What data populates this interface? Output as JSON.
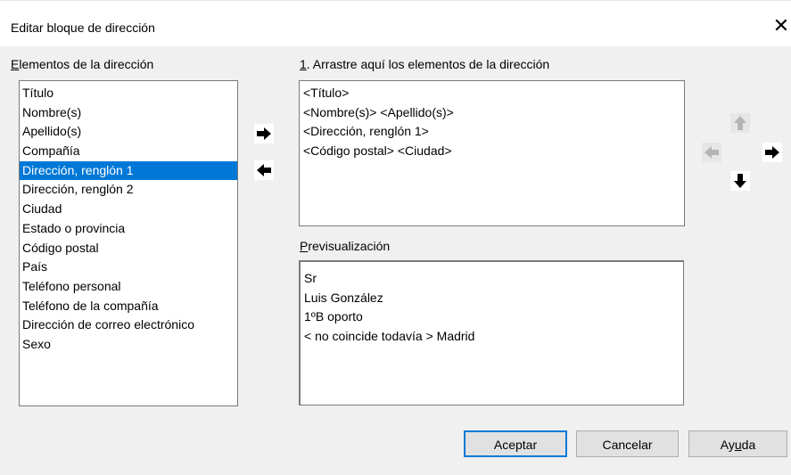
{
  "window": {
    "title": "Editar bloque de dirección",
    "close_glyph": "✕"
  },
  "elements_panel": {
    "label_mnemonic": "E",
    "label_rest": "lementos de la dirección",
    "items": [
      {
        "label": "Título"
      },
      {
        "label": "Nombre(s)"
      },
      {
        "label": "Apellido(s)"
      },
      {
        "label": "Compañía"
      },
      {
        "label": "Dirección, renglón 1"
      },
      {
        "label": "Dirección, renglón 2"
      },
      {
        "label": "Ciudad"
      },
      {
        "label": "Estado o provincia"
      },
      {
        "label": "Código postal"
      },
      {
        "label": "País"
      },
      {
        "label": "Teléfono personal"
      },
      {
        "label": "Teléfono de la compañía"
      },
      {
        "label": "Dirección de correo electrónico"
      },
      {
        "label": "Sexo"
      }
    ],
    "selected_index": 4
  },
  "drag_area": {
    "label_mnemonic": "1",
    "label_rest": ". Arrastre aquí los elementos de la dirección",
    "lines": [
      "<Título>",
      "<Nombre(s)> <Apellido(s)>",
      "<Dirección, renglón 1>",
      "<Código postal> <Ciudad>"
    ]
  },
  "preview": {
    "label_mnemonic": "P",
    "label_rest": "revisualización",
    "lines": [
      "Sr",
      "Luis González",
      "1ºB oporto",
      "< no coincide todavía > Madrid"
    ]
  },
  "arrows": {
    "add_icon": "arrow-right-icon",
    "remove_icon": "arrow-left-icon",
    "move_up_icon": "arrow-up-icon",
    "move_left_icon": "arrow-left-icon",
    "move_right_icon": "arrow-right-icon",
    "move_down_icon": "arrow-down-icon",
    "move_up_enabled": false,
    "move_left_enabled": false
  },
  "buttons": {
    "ok_label": "Aceptar",
    "cancel_label": "Cancelar",
    "help_before": "Ay",
    "help_mnemonic": "u",
    "help_after": "da"
  },
  "colors": {
    "selection": "#0078d7",
    "dialog_bg": "#f0f0f0",
    "button_bg": "#e1e1e1",
    "default_border": "#0078d7"
  }
}
